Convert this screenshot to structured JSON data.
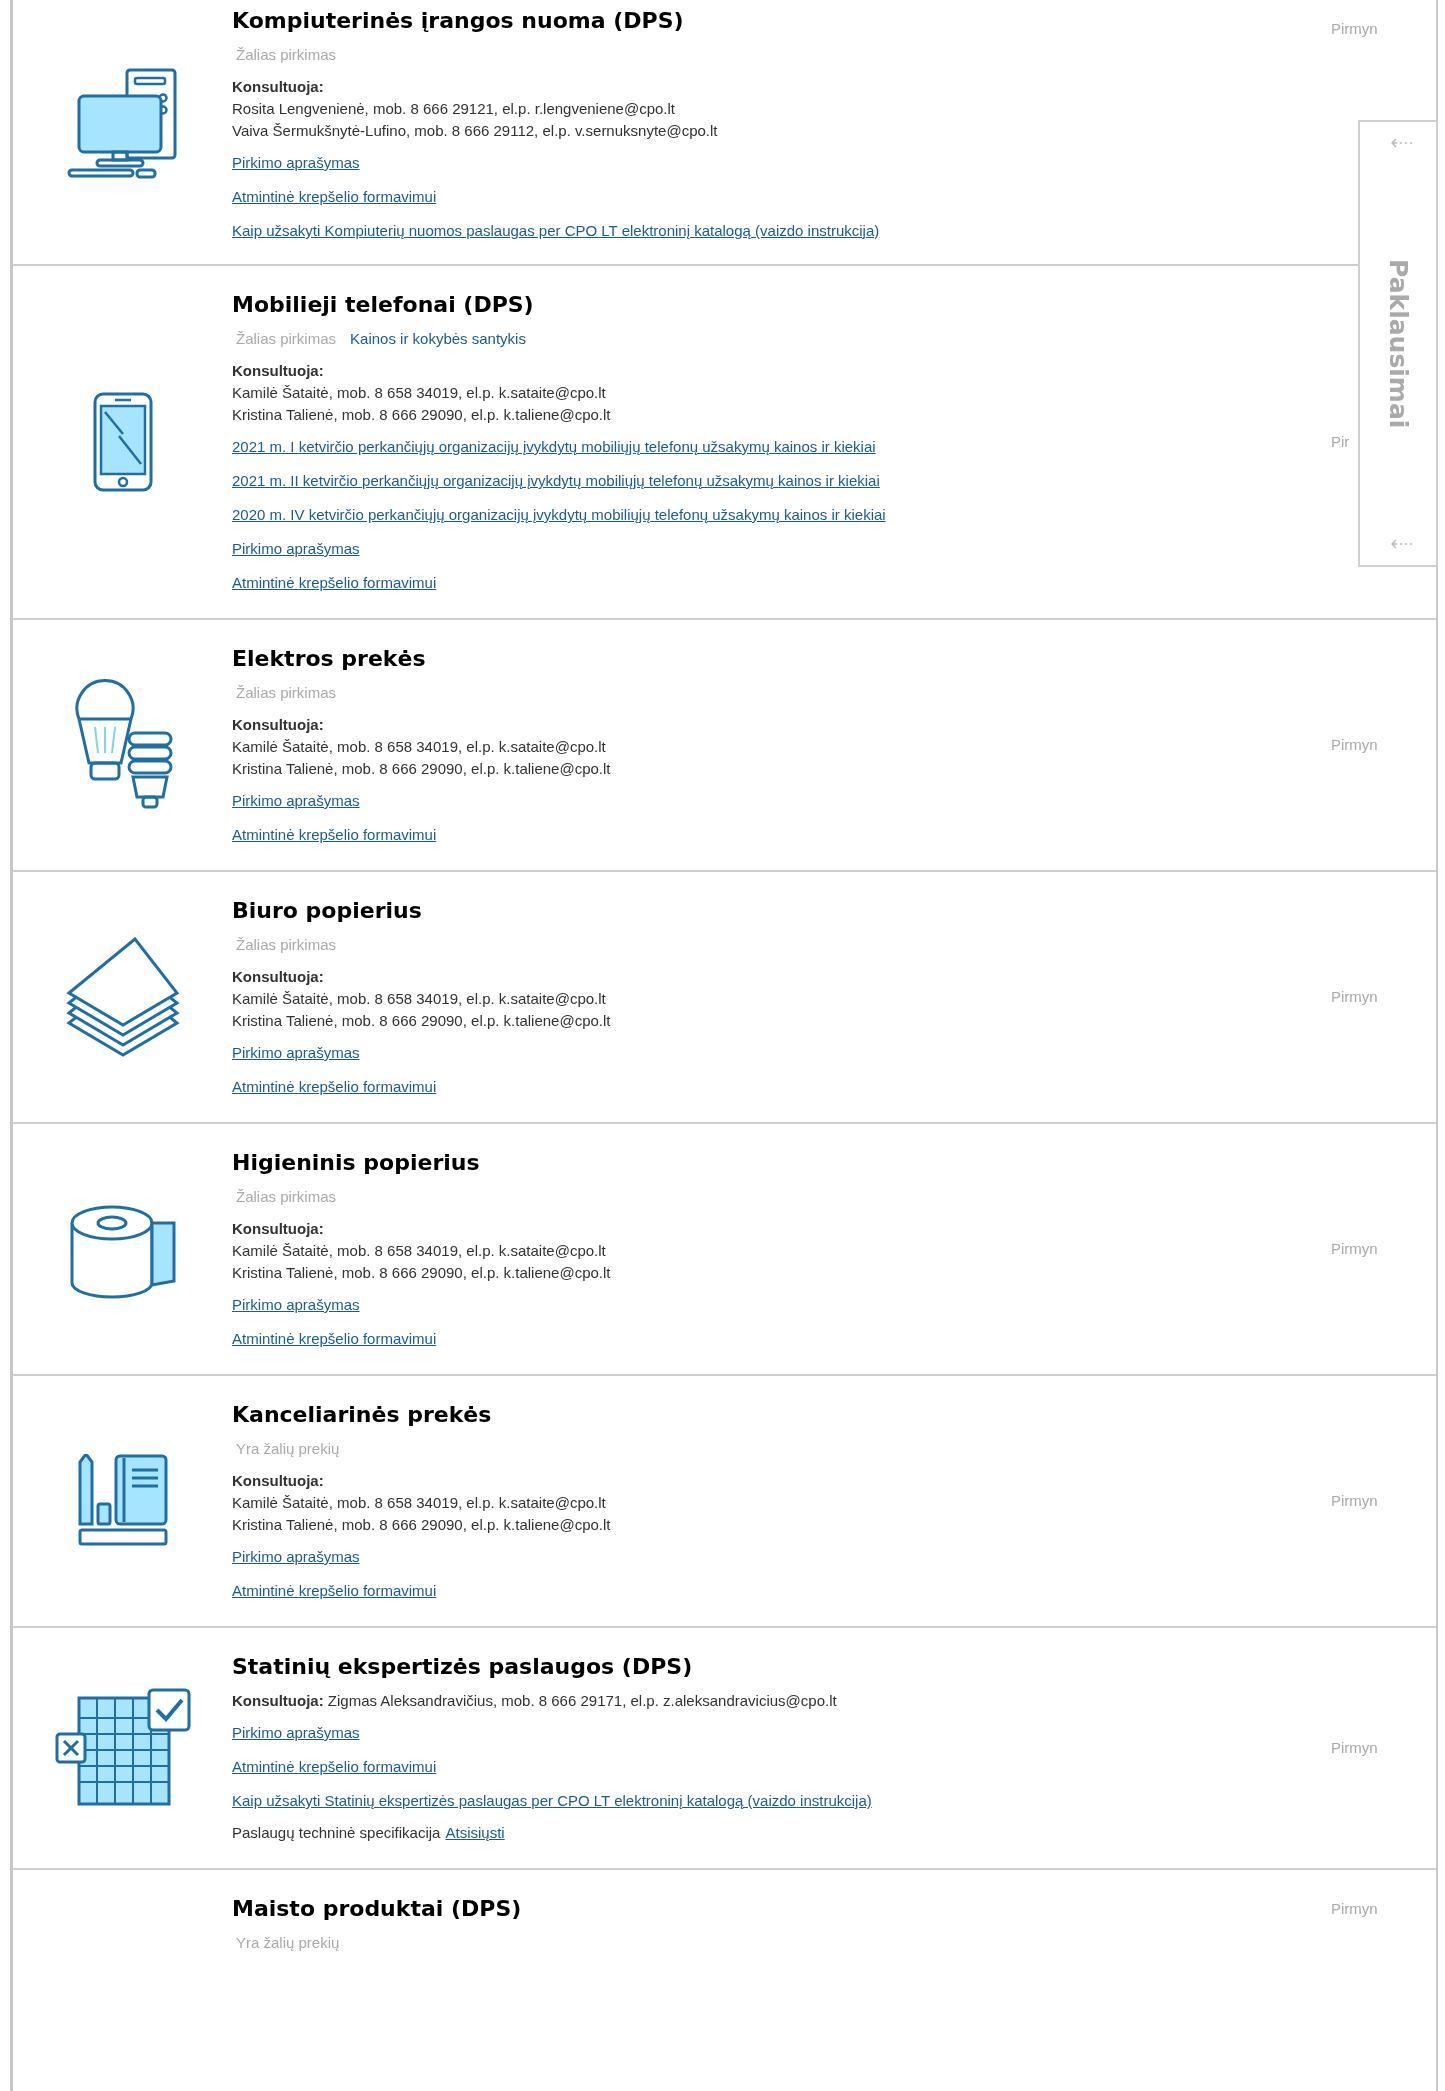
{
  "products": [
    {
      "title": "Kompiuterinės įrangos nuoma (DPS)",
      "tags": [
        {
          "text": "Žalias pirkimas",
          "kind": "green"
        }
      ],
      "consult": {
        "label": "Konsultuoja:",
        "lines": [
          "Rosita Lengvenienė, mob. 8 666 29121, el.p. r.lengveniene@cpo.lt",
          "Vaiva Šermukšnytė-Lufino, mob. 8 666 29112, el.p. v.sernuksnyte@cpo.lt"
        ]
      },
      "links": [
        "Pirkimo aprašymas",
        "Atmintinė krepšelio formavimui",
        "Kaip užsakyti Kompiuterių nuomos paslaugas per CPO LT elektroninį katalogą (vaizdo instrukcija)"
      ],
      "forward": "Pirmyn"
    },
    {
      "title": "Mobilieji telefonai (DPS)",
      "tags": [
        {
          "text": "Žalias pirkimas",
          "kind": "green"
        },
        {
          "text": "Kainos ir kokybės santykis",
          "kind": "quality"
        }
      ],
      "consult": {
        "label": "Konsultuoja:",
        "lines": [
          "Kamilė Šataitė, mob. 8 658 34019, el.p. k.sataite@cpo.lt",
          "Kristina Talienė, mob. 8 666 29090, el.p. k.taliene@cpo.lt"
        ]
      },
      "links": [
        "2021 m. I ketvirčio perkančiųjų organizacijų įvykdytų mobiliųjų telefonų užsakymų kainos ir kiekiai",
        "2021 m. II ketvirčio perkančiųjų organizacijų įvykdytų mobiliųjų telefonų užsakymų kainos ir kiekiai",
        "2020 m. IV ketvirčio perkančiųjų organizacijų įvykdytų mobiliųjų telefonų užsakymų kainos ir kiekiai",
        "Pirkimo aprašymas",
        "Atmintinė krepšelio formavimui"
      ],
      "forward": "Pir"
    },
    {
      "title": "Elektros prekės",
      "tags": [
        {
          "text": "Žalias pirkimas",
          "kind": "green"
        }
      ],
      "consult": {
        "label": "Konsultuoja:",
        "lines": [
          "Kamilė Šataitė, mob. 8 658 34019, el.p. k.sataite@cpo.lt",
          "Kristina Talienė, mob. 8 666 29090, el.p. k.taliene@cpo.lt"
        ]
      },
      "links": [
        "Pirkimo aprašymas",
        "Atmintinė krepšelio formavimui"
      ],
      "forward": "Pirmyn"
    },
    {
      "title": "Biuro popierius",
      "tags": [
        {
          "text": "Žalias pirkimas",
          "kind": "green"
        }
      ],
      "consult": {
        "label": "Konsultuoja:",
        "lines": [
          "Kamilė Šataitė, mob. 8 658 34019, el.p. k.sataite@cpo.lt",
          "Kristina Talienė, mob. 8 666 29090, el.p. k.taliene@cpo.lt"
        ]
      },
      "links": [
        "Pirkimo aprašymas",
        "Atmintinė krepšelio formavimui"
      ],
      "forward": "Pirmyn"
    },
    {
      "title": "Higieninis popierius",
      "tags": [
        {
          "text": "Žalias pirkimas",
          "kind": "green"
        }
      ],
      "consult": {
        "label": "Konsultuoja:",
        "lines": [
          "Kamilė Šataitė, mob. 8 658 34019, el.p. k.sataite@cpo.lt",
          "Kristina Talienė, mob. 8 666 29090, el.p. k.taliene@cpo.lt"
        ]
      },
      "links": [
        "Pirkimo aprašymas",
        "Atmintinė krepšelio formavimui"
      ],
      "forward": "Pirmyn"
    },
    {
      "title": "Kanceliarinės prekės",
      "tags": [
        {
          "text": "Yra žalių prekių",
          "kind": "green"
        }
      ],
      "consult": {
        "label": "Konsultuoja:",
        "lines": [
          "Kamilė Šataitė, mob. 8 658 34019, el.p. k.sataite@cpo.lt",
          "Kristina Talienė, mob. 8 666 29090, el.p. k.taliene@cpo.lt"
        ]
      },
      "links": [
        "Pirkimo aprašymas",
        "Atmintinė krepšelio formavimui"
      ],
      "forward": "Pirmyn"
    },
    {
      "title": "Statinių ekspertizės paslaugos (DPS)",
      "consult_line": "**Konsultuoja:** Zigmas Aleksandravičius, mob. 8 666 29171, el.p. z.aleksandravicius@cpo.lt",
      "links": [
        "Pirkimo aprašymas",
        "Atmintinė krepšelio formavimui",
        "Kaip užsakyti Statinių ekspertizės paslaugas per CPO LT elektroninį katalogą (vaizdo instrukcija)"
      ],
      "spec": {
        "text": "Paslaugų techninė specifikacija",
        "link": "Atsisiųsti"
      },
      "forward": "Pirmyn"
    },
    {
      "title": "Maisto produktai (DPS)",
      "tags": [
        {
          "text": "Yra žalių prekių",
          "kind": "green"
        }
      ],
      "forward": "Pirmyn"
    }
  ],
  "side_panel": {
    "label": "Paklausimai"
  }
}
